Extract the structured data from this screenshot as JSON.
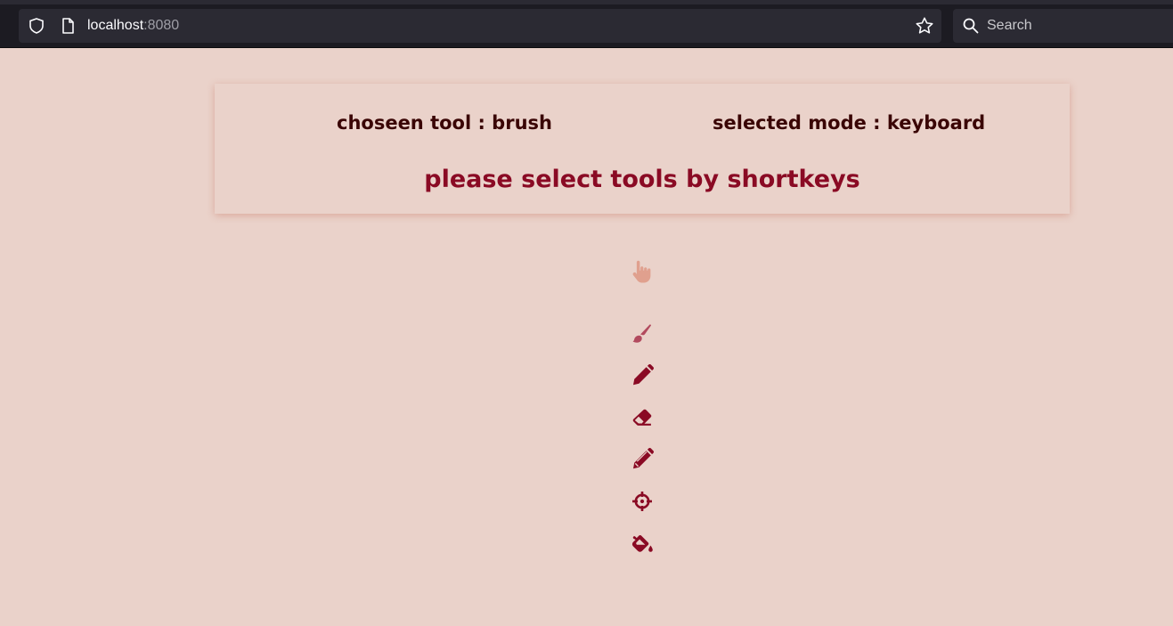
{
  "browser": {
    "url_host": "localhost",
    "url_port": ":8080",
    "search_placeholder": "Search"
  },
  "panel": {
    "tool_status": "choseen tool : brush",
    "mode_status": "selected mode : keyboard",
    "hint": "please select tools by shortkeys"
  },
  "tools": [
    {
      "icon": "hand-pointer-icon",
      "color": "#e0a08e"
    },
    {
      "icon": "brush-icon",
      "color": "#b24a5e",
      "selected": true
    },
    {
      "icon": "pen-icon",
      "color": "#8a0a24"
    },
    {
      "icon": "eraser-icon",
      "color": "#8a0a24"
    },
    {
      "icon": "pencil-icon",
      "color": "#8a0a24"
    },
    {
      "icon": "crosshairs-icon",
      "color": "#8a0a24"
    },
    {
      "icon": "fill-bucket-icon",
      "color": "#8a0a24"
    }
  ],
  "colors": {
    "background": "#ead2ca",
    "status_text": "#3a0505",
    "accent": "#8a0a24"
  }
}
